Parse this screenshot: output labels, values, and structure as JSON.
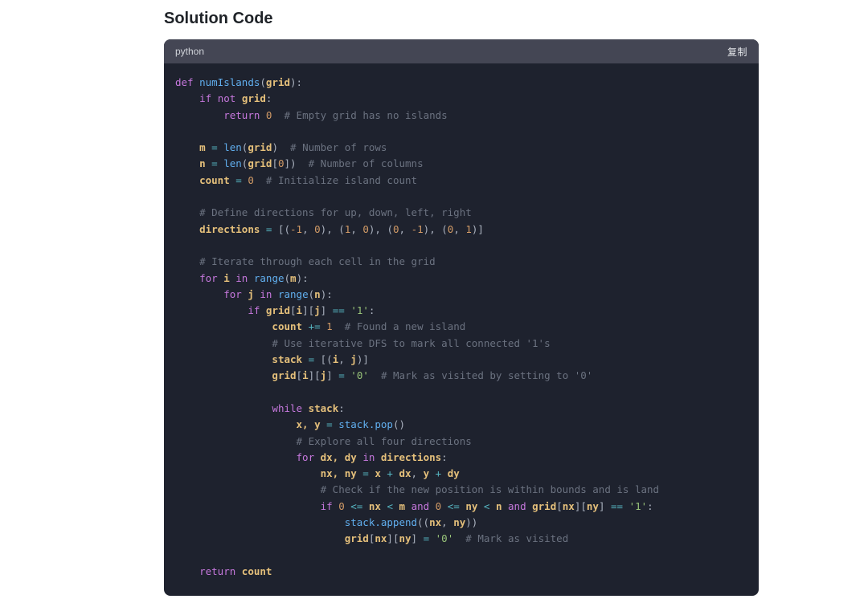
{
  "section_title": "Solution Code",
  "codeblock": {
    "language": "python",
    "copy_label": "复制"
  },
  "code": {
    "l1_def": "def",
    "l1_fn": "numIslands",
    "l1_p": "(",
    "l1_a": "grid",
    "l1_q": "):",
    "l2_if": "if",
    "l2_not": "not",
    "l2_g": "grid",
    "l2_c": ":",
    "l3_ret": "return",
    "l3_0": "0",
    "l3_cmt": "# Empty grid has no islands",
    "l5_m": "m",
    "l5_eq": " = ",
    "l5_len": "len",
    "l5_p": "(",
    "l5_g": "grid",
    "l5_q": ")",
    "l5_cmt": "# Number of rows",
    "l6_n": "n",
    "l6_eq": " = ",
    "l6_len": "len",
    "l6_p": "(",
    "l6_g": "grid",
    "l6_b": "[",
    "l6_0": "0",
    "l6_bb": "])",
    "l6_cmt": "# Number of columns",
    "l7_c": "count",
    "l7_eq": " = ",
    "l7_0": "0",
    "l7_cmt": "# Initialize island count",
    "l9_cmt": "# Define directions for up, down, left, right",
    "l10_d": "directions",
    "l10_eq": " = ",
    "l10_body": "[(",
    "l10_n1": "-1",
    "l10_c1": ", ",
    "l10_z1": "0",
    "l10_c2": "), (",
    "l10_p1": "1",
    "l10_c3": ", ",
    "l10_z2": "0",
    "l10_c4": "), (",
    "l10_z3": "0",
    "l10_c5": ", ",
    "l10_n2": "-1",
    "l10_c6": "), (",
    "l10_z4": "0",
    "l10_c7": ", ",
    "l10_p2": "1",
    "l10_c8": ")]",
    "l12_cmt": "# Iterate through each cell in the grid",
    "l13_for": "for",
    "l13_i": "i",
    "l13_in": "in",
    "l13_rng": "range",
    "l13_p": "(",
    "l13_m": "m",
    "l13_q": "):",
    "l14_for": "for",
    "l14_j": "j",
    "l14_in": "in",
    "l14_rng": "range",
    "l14_p": "(",
    "l14_n": "n",
    "l14_q": "):",
    "l15_if": "if",
    "l15_g": "grid",
    "l15_b": "[",
    "l15_i": "i",
    "l15_m": "][",
    "l15_j": "j",
    "l15_e": "]",
    "l15_eq": " == ",
    "l15_s": "'1'",
    "l15_c": ":",
    "l16_c": "count",
    "l16_op": " += ",
    "l16_1": "1",
    "l16_cmt": "# Found a new island",
    "l17_cmt": "# Use iterative DFS to mark all connected '1's",
    "l18_s": "stack",
    "l18_eq": " = ",
    "l18_b": "[(",
    "l18_i": "i",
    "l18_c": ", ",
    "l18_j": "j",
    "l18_e": ")]",
    "l19_g": "grid",
    "l19_b": "[",
    "l19_i": "i",
    "l19_m": "][",
    "l19_j": "j",
    "l19_e": "]",
    "l19_eq": " = ",
    "l19_s": "'0'",
    "l19_cmt": "# Mark as visited by setting to '0'",
    "l21_w": "while",
    "l21_s": "stack",
    "l21_c": ":",
    "l22_xy": "x, y",
    "l22_eq": " = ",
    "l22_s": "stack.pop",
    "l22_p": "()",
    "l23_cmt": "# Explore all four directions",
    "l24_for": "for",
    "l24_d": "dx, dy",
    "l24_in": "in",
    "l24_dir": "directions",
    "l24_c": ":",
    "l25_nxy": "nx, ny",
    "l25_eq": " = ",
    "l25_x": "x",
    "l25_p1": " + ",
    "l25_dx": "dx",
    "l25_c": ", ",
    "l25_y": "y",
    "l25_p2": " + ",
    "l25_dy": "dy",
    "l26_cmt": "# Check if the new position is within bounds and is land",
    "l27_if": "if",
    "l27_z1": "0",
    "l27_le1": " <= ",
    "l27_nx": "nx",
    "l27_lt1": " < ",
    "l27_m": "m",
    "l27_and1": "and",
    "l27_z2": "0",
    "l27_le2": " <= ",
    "l27_ny": "ny",
    "l27_lt2": " < ",
    "l27_n": "n",
    "l27_and2": "and",
    "l27_g": "grid",
    "l27_b": "[",
    "l27_nxb": "nx",
    "l27_mm": "][",
    "l27_nyb": "ny",
    "l27_e": "]",
    "l27_eq": " == ",
    "l27_s": "'1'",
    "l27_c": ":",
    "l28_s": "stack.append",
    "l28_p": "((",
    "l28_nx": "nx",
    "l28_c": ", ",
    "l28_ny": "ny",
    "l28_q": "))",
    "l29_g": "grid",
    "l29_b": "[",
    "l29_nx": "nx",
    "l29_m": "][",
    "l29_ny": "ny",
    "l29_e": "]",
    "l29_eq": " = ",
    "l29_s": "'0'",
    "l29_cmt": "# Mark as visited",
    "l31_ret": "return",
    "l31_c": "count"
  }
}
